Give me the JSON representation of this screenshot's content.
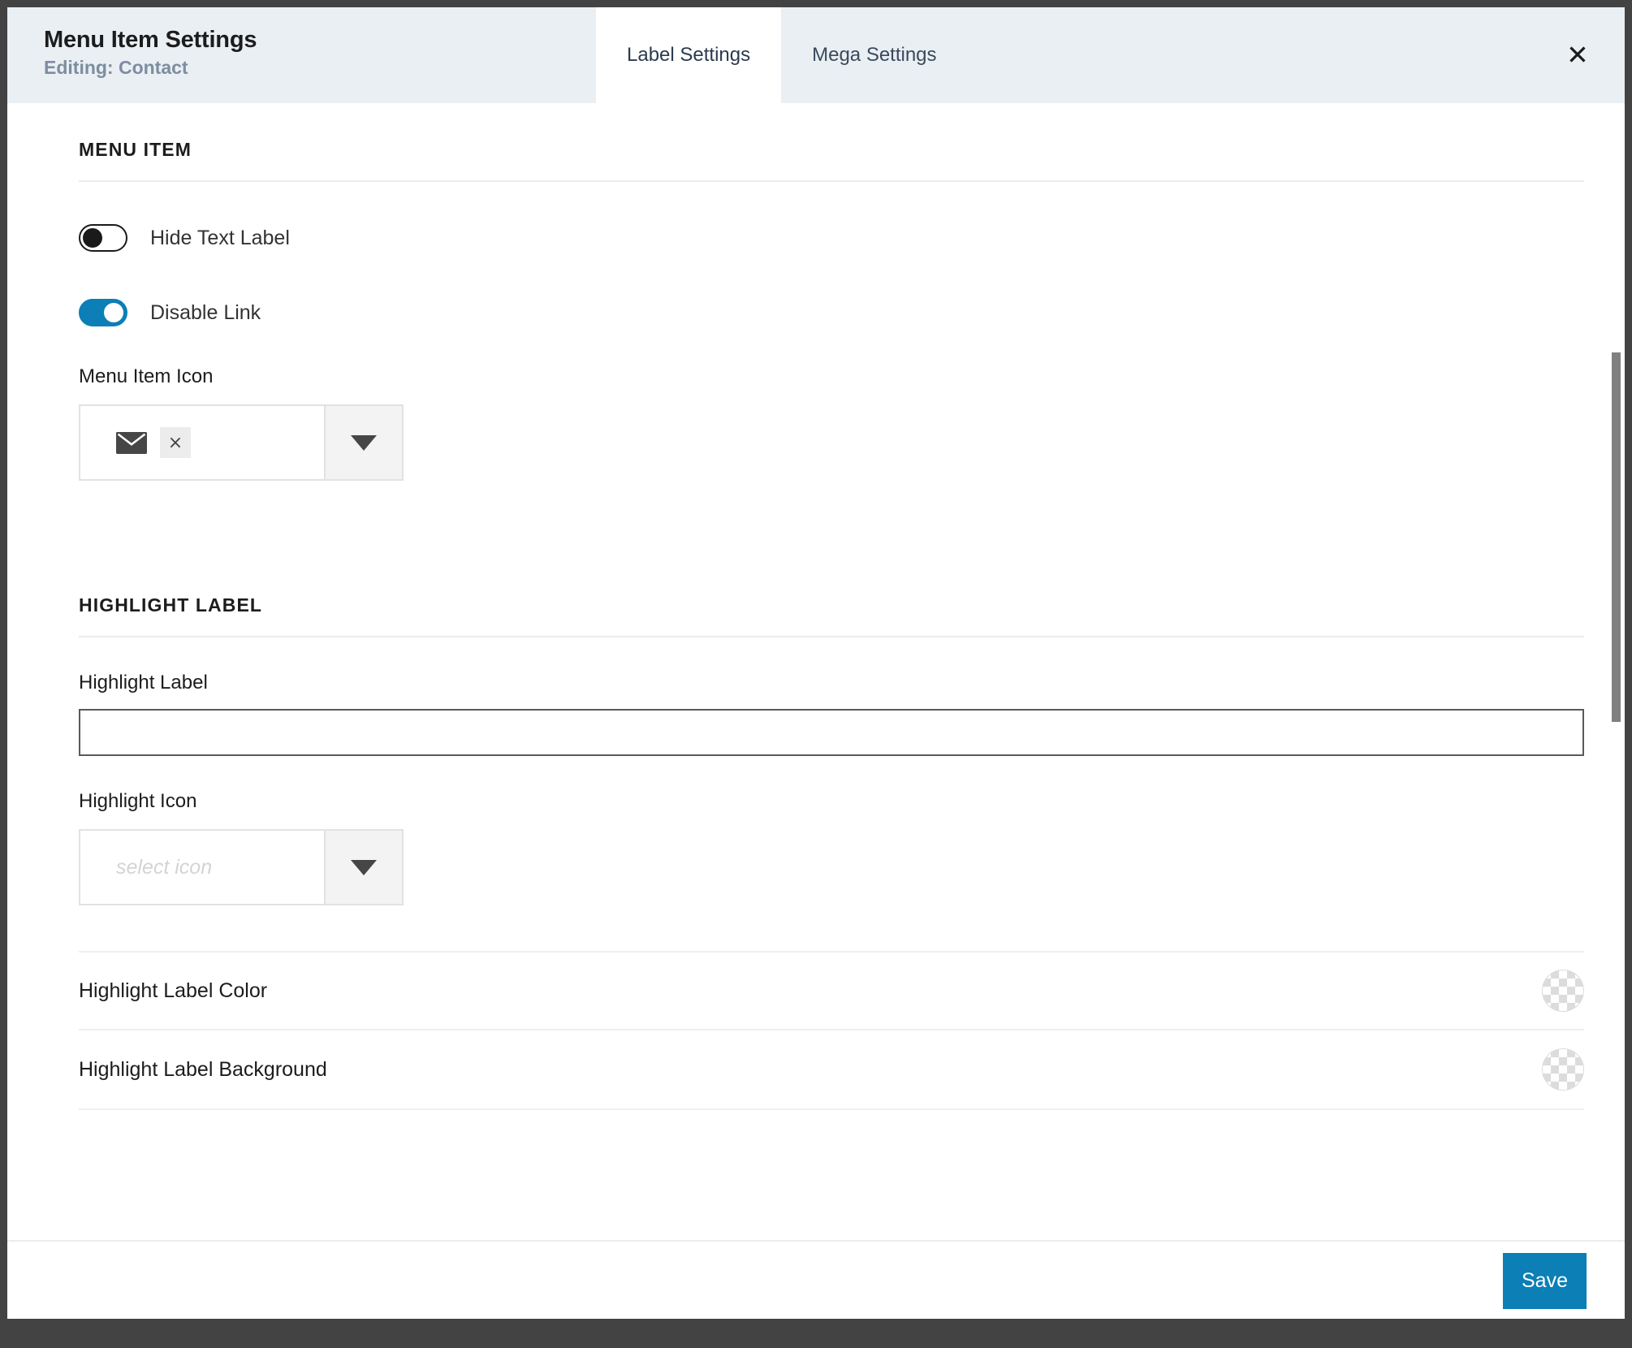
{
  "background": {
    "partial_text": "Menu Item Settings"
  },
  "header": {
    "title": "Menu Item Settings",
    "subtitle": "Editing: Contact",
    "close_label": "✕",
    "tabs": [
      {
        "label": "Label Settings",
        "active": true
      },
      {
        "label": "Mega Settings",
        "active": false
      }
    ]
  },
  "sections": {
    "menu_item": {
      "heading": "MENU ITEM",
      "toggles": [
        {
          "label": "Hide Text Label",
          "state": "off"
        },
        {
          "label": "Disable Link",
          "state": "on"
        }
      ],
      "icon_field": {
        "label": "Menu Item Icon",
        "selected_icon": "envelope-icon",
        "clear_label": "×",
        "dropdown_label": "▼"
      }
    },
    "highlight_label": {
      "heading": "HIGHLIGHT LABEL",
      "label_field": {
        "label": "Highlight Label",
        "value": "",
        "placeholder": ""
      },
      "icon_field": {
        "label": "Highlight Icon",
        "placeholder": "select icon",
        "dropdown_label": "▼"
      },
      "color_rows": [
        {
          "label": "Highlight Label Color",
          "value": "transparent"
        },
        {
          "label": "Highlight Label Background",
          "value": "transparent"
        }
      ]
    }
  },
  "footer": {
    "save_label": "Save"
  },
  "colors": {
    "accent": "#0b7fb6",
    "header_bg": "#eaeff3",
    "subtitle": "#7d8da1",
    "frame": "#434343"
  }
}
